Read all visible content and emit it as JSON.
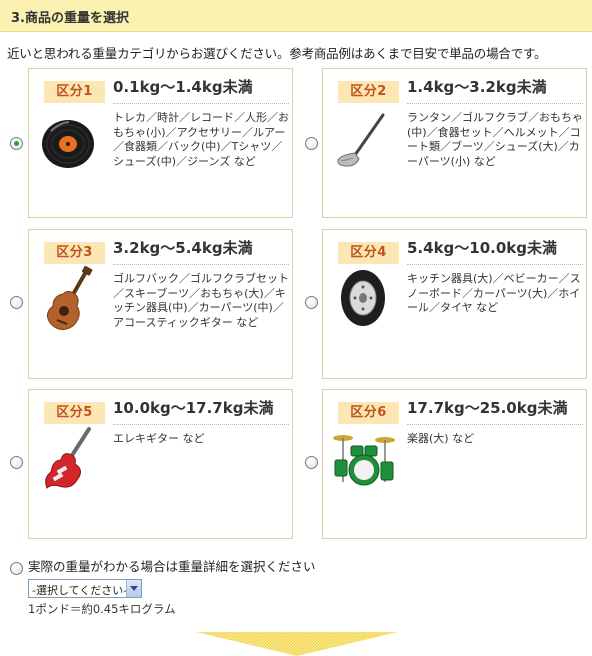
{
  "section": {
    "title": "3.商品の重量を選択",
    "intro": "近いと思われる重量カテゴリからお選びください。参考商品例はあくまで目安で単品の場合です。"
  },
  "categories": [
    {
      "badge": "区分1",
      "weight": "0.1kg〜1.4kg未満",
      "items": "トレカ／時計／レコード／人形／おもちゃ(小)／アクセサリー／ルアー／食器類／バック(中)／Tシャツ／シューズ(中)／ジーンズ など",
      "icon": "record-icon",
      "selected": true
    },
    {
      "badge": "区分2",
      "weight": "1.4kg〜3.2kg未満",
      "items": "ランタン／ゴルフクラブ／おもちゃ(中)／食器セット／ヘルメット／コート類／ブーツ／シューズ(大)／カーパーツ(小) など",
      "icon": "golf-club-icon",
      "selected": false
    },
    {
      "badge": "区分3",
      "weight": "3.2kg〜5.4kg未満",
      "items": "ゴルフバック／ゴルフクラブセット／スキーブーツ／おもちゃ(大)／キッチン器具(中)／カーパーツ(中)／アコースティックギター など",
      "icon": "acoustic-guitar-icon",
      "selected": false
    },
    {
      "badge": "区分4",
      "weight": "5.4kg〜10.0kg未満",
      "items": "キッチン器具(大)／ベビーカー／スノーボード／カーパーツ(大)／ホイール／タイヤ など",
      "icon": "tire-icon",
      "selected": false
    },
    {
      "badge": "区分5",
      "weight": "10.0kg〜17.7kg未満",
      "items": "エレキギター など",
      "icon": "electric-guitar-icon",
      "selected": false
    },
    {
      "badge": "区分6",
      "weight": "17.7kg〜25.0kg未満",
      "items": "楽器(大) など",
      "icon": "drum-kit-icon",
      "selected": false
    }
  ],
  "detail": {
    "label": "実際の重量がわかる場合は重量詳細を選択ください",
    "select_value": "-選択してください-",
    "note": "1ポンド＝約0.45キログラム"
  },
  "colors": {
    "header_bg": "#fbf1b0",
    "badge_bg": "#fbe6b4",
    "badge_text": "#c0531e",
    "card_border": "#d9d0a8",
    "arrow": "#f8e27a"
  }
}
